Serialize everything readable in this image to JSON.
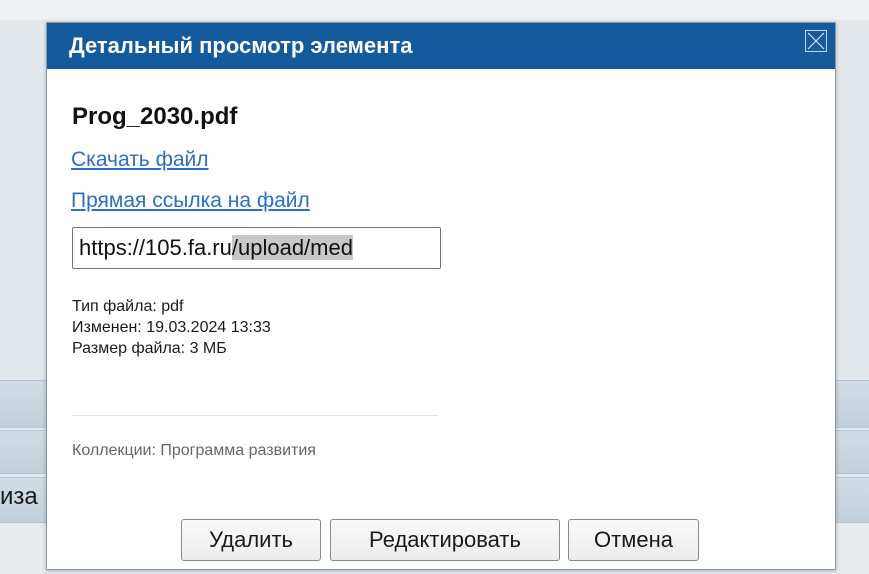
{
  "background": {
    "partial_text": "иза"
  },
  "dialog": {
    "title": "Детальный просмотр элемента",
    "close_icon": "close-x-icon",
    "file_name": "Prog_2030.pdf",
    "download_link": "Скачать файл",
    "direct_link": "Прямая ссылка на файл",
    "url_value_prefix": "https://105.fa.ru",
    "url_value_selected": "/upload/med",
    "meta": {
      "file_type": "Тип файла: pdf",
      "modified": "Изменен: 19.03.2024 13:33",
      "file_size": "Размер файла: 3 МБ"
    },
    "collections": "Коллекции: Программа развития",
    "buttons": {
      "delete": "Удалить",
      "edit": "Редактировать",
      "cancel": "Отмена"
    },
    "colors": {
      "header_bg": "#155a9c",
      "link": "#2d6fc2"
    }
  }
}
